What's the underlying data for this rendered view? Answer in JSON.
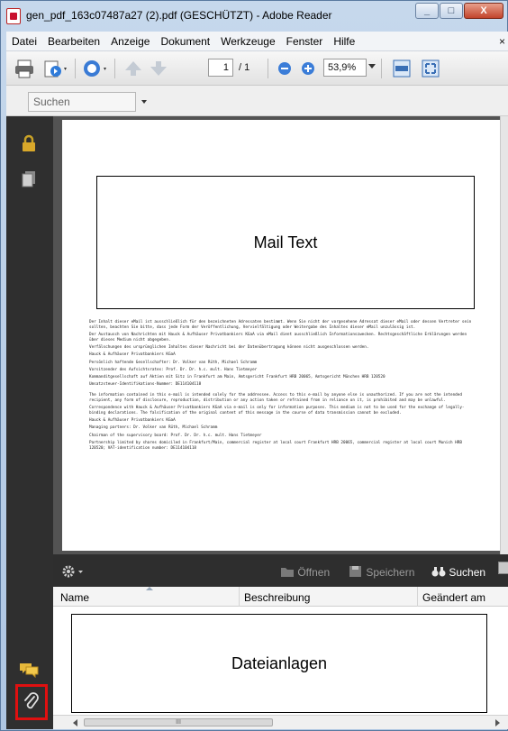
{
  "window": {
    "title": "gen_pdf_163c07487a27 (2).pdf (GESCHÜTZT) - Adobe Reader"
  },
  "menubar": {
    "items": [
      "Datei",
      "Bearbeiten",
      "Anzeige",
      "Dokument",
      "Werkzeuge",
      "Fenster",
      "Hilfe"
    ],
    "close_glyph": "×"
  },
  "toolbar": {
    "current_page": "1",
    "page_total": "/ 1",
    "zoom": "53,9%"
  },
  "findbar": {
    "placeholder": "Suchen"
  },
  "document": {
    "mail_text": "Mail Text",
    "disclaimer_de": [
      "Der Inhalt dieser eMail ist ausschließlich für den bezeichneten Adressaten bestimmt. Wenn Sie nicht der vorgesehene Adressat dieser eMail oder dessen Vertreter sein sollten, beachten Sie bitte, dass jede Form der Veröffentlichung, Vervielfältigung oder Weitergabe des Inhaltes dieser eMail unzulässig ist.",
      "Der Austausch von Nachrichten mit Hauck & Aufhäuser Privatbankiers KGaA via eMail dient ausschließlich Informationszwecken. Rechtsgeschäftliche Erklärungen werden über dieses Medium nicht abgegeben.",
      "Verfälschungen des ursprünglichen Inhaltes dieser Nachricht bei der Datenübertragung können nicht ausgeschlossen werden.",
      "Hauck & Aufhäuser Privatbankiers KGaA",
      "Persönlich haftende Gesellschafter: Dr. Volker van Rüth, Michael Schramm",
      "Vorsitzender des Aufsichtsrates: Prof. Dr. Dr. h.c. mult. Hans Tietmeyer",
      "Kommanditgesellschaft auf Aktien mit Sitz in Frankfurt am Main, Amtsgericht Frankfurt HRB 20065, Amtsgericht München HRB 120520",
      "Umsatzsteuer-Identifikations-Nummer: DE114104118"
    ],
    "disclaimer_en": [
      "The information contained in this e-mail is intended solely for the addressee. Access to this e-mail by anyone else is unauthorized. If you are not the intended recipient, any form of disclosure, reproduction, distribution or any action taken or refrained from in reliance on it, is prohibited and may be unlawful.",
      "Correspondence with Hauck & Aufhäuser Privatbankiers KGaA via e-mail is only for information purposes. This medium is not to be used for the exchange of legally-binding declarations. The falsification of the original content of this message in the course of data transmission cannot be excluded.",
      "Hauck & Aufhäuser Privatbankiers KGaA",
      "Managing partners: Dr. Volker van Rüth, Michael Schramm",
      "Chairman of the supervisory board: Prof. Dr. Dr. h.c. mult. Hans Tietmeyer",
      "Partnership limited by shares domiciled in Frankfurt/Main, commercial register at local court Frankfurt HRB 20065, commercial register at local court Munich HRB 120520; VAT-identification number: DE114104118"
    ]
  },
  "attachments": {
    "toolbar": {
      "open": "Öffnen",
      "save": "Speichern",
      "search": "Suchen"
    },
    "columns": {
      "name": "Name",
      "description": "Beschreibung",
      "modified": "Geändert am"
    },
    "placeholder": "Dateianlagen",
    "scroll_thumb": "III"
  },
  "colors": {
    "nav_pane": "#2f2f2f",
    "doc_background": "#535353",
    "highlight": "#e01010"
  }
}
